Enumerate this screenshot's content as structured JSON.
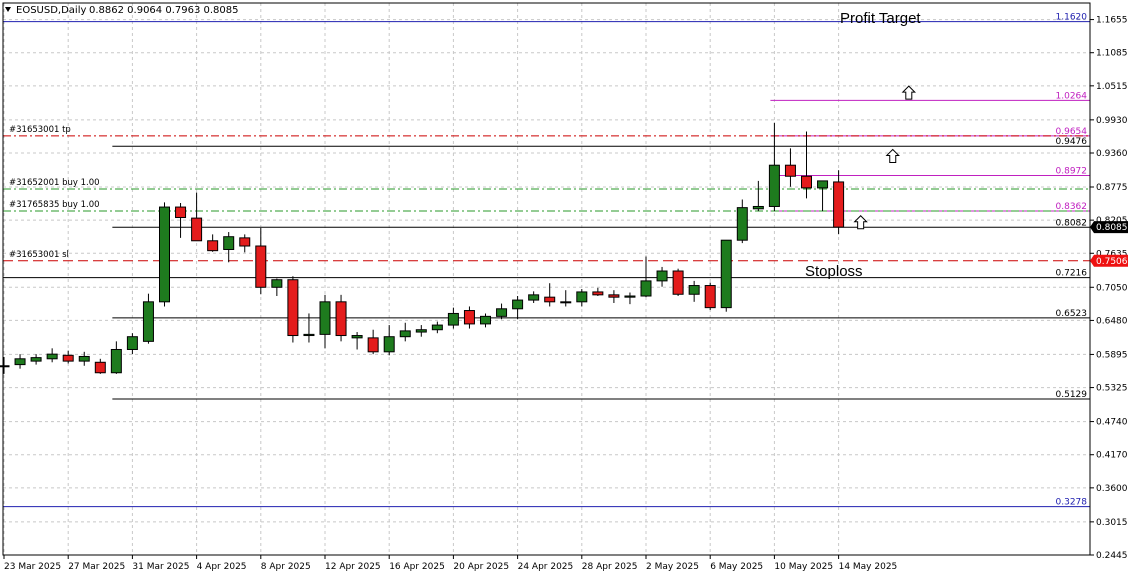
{
  "header": {
    "symbol": "EOSUSD,Daily",
    "ohlc": "0.8862 0.9064 0.7963 0.8085"
  },
  "annotations": {
    "profit_target": "Profit Target",
    "stoploss": "Stoploss"
  },
  "order_labels": [
    {
      "text": "#31653001 tp",
      "price": 0.9654
    },
    {
      "text": "#31652001 buy 1.00",
      "price": 0.874
    },
    {
      "text": "#31765835 buy 1.00",
      "price": 0.8362
    },
    {
      "text": "#31653001 sl",
      "price": 0.7506
    }
  ],
  "colors": {
    "bull": "#1e7b1e",
    "bear": "#e41c1c",
    "wick": "#000000",
    "grid": "#c8c8c8",
    "blue_level": "#2020b0",
    "magenta_level": "#c020c0",
    "red_dash": "#cc0000",
    "green_dash": "#2a9a2a",
    "price_tag_bg": "#000000",
    "sl_tag_bg": "#ee1111"
  },
  "chart_data": {
    "type": "candlestick",
    "symbol": "EOSUSD",
    "timeframe": "Daily",
    "ylim": [
      0.2445,
      1.194
    ],
    "y_ticks": [
      0.2445,
      0.3015,
      0.36,
      0.417,
      0.474,
      0.5325,
      0.5895,
      0.648,
      0.705,
      0.7635,
      0.8205,
      0.8775,
      0.936,
      0.993,
      1.0515,
      1.1085,
      1.1655
    ],
    "x_labels": [
      "23 Mar 2025",
      "27 Mar 2025",
      "31 Mar 2025",
      "4 Apr 2025",
      "8 Apr 2025",
      "12 Apr 2025",
      "16 Apr 2025",
      "20 Apr 2025",
      "24 Apr 2025",
      "28 Apr 2025",
      "2 May 2025",
      "6 May 2025",
      "10 May 2025",
      "14 May 2025"
    ],
    "candles": [
      {
        "o": 0.57,
        "h": 0.585,
        "l": 0.556,
        "c": 0.57
      },
      {
        "o": 0.572,
        "h": 0.59,
        "l": 0.565,
        "c": 0.582
      },
      {
        "o": 0.578,
        "h": 0.59,
        "l": 0.572,
        "c": 0.584
      },
      {
        "o": 0.582,
        "h": 0.6,
        "l": 0.576,
        "c": 0.59
      },
      {
        "o": 0.588,
        "h": 0.596,
        "l": 0.574,
        "c": 0.578
      },
      {
        "o": 0.578,
        "h": 0.594,
        "l": 0.57,
        "c": 0.586
      },
      {
        "o": 0.576,
        "h": 0.582,
        "l": 0.556,
        "c": 0.558
      },
      {
        "o": 0.558,
        "h": 0.612,
        "l": 0.556,
        "c": 0.598
      },
      {
        "o": 0.598,
        "h": 0.626,
        "l": 0.59,
        "c": 0.62
      },
      {
        "o": 0.612,
        "h": 0.694,
        "l": 0.608,
        "c": 0.68
      },
      {
        "o": 0.68,
        "h": 0.851,
        "l": 0.672,
        "c": 0.843
      },
      {
        "o": 0.843,
        "h": 0.85,
        "l": 0.79,
        "c": 0.825
      },
      {
        "o": 0.824,
        "h": 0.868,
        "l": 0.786,
        "c": 0.785
      },
      {
        "o": 0.785,
        "h": 0.796,
        "l": 0.766,
        "c": 0.768
      },
      {
        "o": 0.77,
        "h": 0.8,
        "l": 0.748,
        "c": 0.792
      },
      {
        "o": 0.79,
        "h": 0.796,
        "l": 0.765,
        "c": 0.776
      },
      {
        "o": 0.776,
        "h": 0.807,
        "l": 0.693,
        "c": 0.705
      },
      {
        "o": 0.705,
        "h": 0.72,
        "l": 0.69,
        "c": 0.718
      },
      {
        "o": 0.718,
        "h": 0.724,
        "l": 0.61,
        "c": 0.622
      },
      {
        "o": 0.622,
        "h": 0.66,
        "l": 0.61,
        "c": 0.624
      },
      {
        "o": 0.624,
        "h": 0.692,
        "l": 0.6,
        "c": 0.68
      },
      {
        "o": 0.68,
        "h": 0.692,
        "l": 0.612,
        "c": 0.622
      },
      {
        "o": 0.618,
        "h": 0.628,
        "l": 0.598,
        "c": 0.622
      },
      {
        "o": 0.618,
        "h": 0.632,
        "l": 0.59,
        "c": 0.594
      },
      {
        "o": 0.594,
        "h": 0.64,
        "l": 0.588,
        "c": 0.62
      },
      {
        "o": 0.62,
        "h": 0.644,
        "l": 0.612,
        "c": 0.63
      },
      {
        "o": 0.628,
        "h": 0.64,
        "l": 0.62,
        "c": 0.632
      },
      {
        "o": 0.632,
        "h": 0.646,
        "l": 0.626,
        "c": 0.64
      },
      {
        "o": 0.64,
        "h": 0.67,
        "l": 0.634,
        "c": 0.66
      },
      {
        "o": 0.665,
        "h": 0.672,
        "l": 0.634,
        "c": 0.642
      },
      {
        "o": 0.642,
        "h": 0.66,
        "l": 0.636,
        "c": 0.655
      },
      {
        "o": 0.655,
        "h": 0.677,
        "l": 0.65,
        "c": 0.668
      },
      {
        "o": 0.668,
        "h": 0.69,
        "l": 0.65,
        "c": 0.683
      },
      {
        "o": 0.683,
        "h": 0.698,
        "l": 0.678,
        "c": 0.692
      },
      {
        "o": 0.688,
        "h": 0.712,
        "l": 0.672,
        "c": 0.68
      },
      {
        "o": 0.68,
        "h": 0.7,
        "l": 0.672,
        "c": 0.68
      },
      {
        "o": 0.68,
        "h": 0.702,
        "l": 0.672,
        "c": 0.697
      },
      {
        "o": 0.697,
        "h": 0.704,
        "l": 0.69,
        "c": 0.692
      },
      {
        "o": 0.692,
        "h": 0.7,
        "l": 0.678,
        "c": 0.688
      },
      {
        "o": 0.688,
        "h": 0.696,
        "l": 0.676,
        "c": 0.69
      },
      {
        "o": 0.69,
        "h": 0.758,
        "l": 0.688,
        "c": 0.716
      },
      {
        "o": 0.716,
        "h": 0.74,
        "l": 0.706,
        "c": 0.733
      },
      {
        "o": 0.733,
        "h": 0.737,
        "l": 0.69,
        "c": 0.693
      },
      {
        "o": 0.693,
        "h": 0.716,
        "l": 0.68,
        "c": 0.708
      },
      {
        "o": 0.708,
        "h": 0.713,
        "l": 0.666,
        "c": 0.67
      },
      {
        "o": 0.67,
        "h": 0.782,
        "l": 0.663,
        "c": 0.786
      },
      {
        "o": 0.786,
        "h": 0.856,
        "l": 0.781,
        "c": 0.842
      },
      {
        "o": 0.84,
        "h": 0.888,
        "l": 0.836,
        "c": 0.844
      },
      {
        "o": 0.844,
        "h": 0.988,
        "l": 0.836,
        "c": 0.915
      },
      {
        "o": 0.915,
        "h": 0.944,
        "l": 0.878,
        "c": 0.896
      },
      {
        "o": 0.896,
        "h": 0.973,
        "l": 0.858,
        "c": 0.876
      },
      {
        "o": 0.876,
        "h": 0.886,
        "l": 0.836,
        "c": 0.888
      },
      {
        "o": 0.8862,
        "h": 0.9064,
        "l": 0.7963,
        "c": 0.8085
      }
    ],
    "levels": [
      {
        "label": "1.1620",
        "price": 1.162,
        "style": "blue",
        "x_start": 0
      },
      {
        "label": "1.0264",
        "price": 1.0264,
        "style": "magenta",
        "x_start": 48
      },
      {
        "label": "0.9654",
        "price": 0.9654,
        "style": "magenta",
        "x_start": 48
      },
      {
        "label": "0.9476",
        "price": 0.9476,
        "style": "black",
        "x_start": 7
      },
      {
        "label": "0.8972",
        "price": 0.8972,
        "style": "magenta",
        "x_start": 48
      },
      {
        "label": "0.8362",
        "price": 0.8362,
        "style": "magenta",
        "x_start": 48
      },
      {
        "label": "0.8082",
        "price": 0.8082,
        "style": "black",
        "x_start": 7
      },
      {
        "label": "0.7216",
        "price": 0.7216,
        "style": "black",
        "x_start": 0
      },
      {
        "label": "0.6523",
        "price": 0.6523,
        "style": "black",
        "x_start": 7
      },
      {
        "label": "0.5129",
        "price": 0.5129,
        "style": "black",
        "x_start": 7
      },
      {
        "label": "0.3278",
        "price": 0.3278,
        "style": "blue",
        "x_start": 0
      }
    ],
    "order_lines": [
      {
        "price": 0.9654,
        "style": "red_dashdot"
      },
      {
        "price": 0.874,
        "style": "green_dashdot"
      },
      {
        "price": 0.8362,
        "style": "green_dashdot"
      },
      {
        "price": 0.7506,
        "style": "red_dash"
      }
    ],
    "price_tags": [
      {
        "label": "0.8085",
        "price": 0.8085,
        "kind": "current"
      },
      {
        "label": "0.7506",
        "price": 0.7506,
        "kind": "stop"
      }
    ],
    "arrows": [
      {
        "candle": 56,
        "price": 1.039
      },
      {
        "candle": 55,
        "price": 0.93
      },
      {
        "candle": 53,
        "price": 0.816
      }
    ]
  }
}
